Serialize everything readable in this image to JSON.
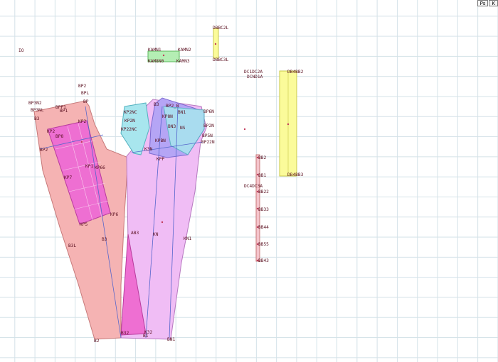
{
  "toolbar": {
    "btn1": "Ps",
    "btn2": "K"
  },
  "colors": {
    "back_piece": "#f5b3b3",
    "front_piece": "#f0bdf5",
    "pocket_fill": "#ee6fd2",
    "yoke_fill": "#a8e6ee",
    "grid": "#d4e2e8",
    "label": "#5a1020",
    "small_green": "#b4eeb4",
    "yellow_strip": "#fbfb9a",
    "pink_strip": "#f5c4cc"
  },
  "labels": {
    "io": "IO",
    "bp2": "BP2",
    "bpl": "BPL",
    "bp": "BP",
    "bp3n2": "BP3N2",
    "bp3nl": "BP3NL",
    "bpp1": "BPP1",
    "bp2b": "BP2",
    "b3": "B3",
    "bp1": "BP1",
    "bp8": "BP8",
    "kp2": "KP2",
    "kp2b": "KP2",
    "k1": "KP1",
    "k7": "KP7",
    "kp6": "KP6",
    "kp66": "KP66",
    "kp5": "KP5",
    "kp2nc": "KP2NC",
    "kp2n": "KP2N",
    "kp22nc": "KP22NC",
    "kp8n": "KP8N",
    "b3top": "B3",
    "bn1": "BN1",
    "bn3": "BN3",
    "bp2b2": "BP2_B",
    "bp6n": "BP6N",
    "bp2n": "BP2N",
    "bp5n": "BP5N",
    "bp22n": "BP22N",
    "ns": "NS",
    "kpp": "KPP",
    "kpsn": "KPBN",
    "k3n": "K3N",
    "ab3": "AB3",
    "b1": "B1",
    "b3l": "B3L",
    "b3b": "B3",
    "b2": "B2",
    "b32": "B32",
    "k32": "K32",
    "kn": "KN",
    "bn1b": "BN1",
    "kn1": "KN1",
    "gr1": "KAMN1",
    "gr2": "KAMN2",
    "gr3": "KAM8N0",
    "gr4": "KAMN3",
    "y1a": "DBBC2L",
    "y1b": "DBBC3L",
    "dc1": "DC1DC2A",
    "dc2": "DCND1A",
    "y2a": "DB4BB2",
    "y2b": "DB4BB3",
    "dc4": "DC4DC3A",
    "p1": "BB2",
    "p2": "BB1",
    "p3": "BB22",
    "p4": "BB33",
    "p5": "BB44",
    "p6": "BB55",
    "p7": "BB43"
  }
}
